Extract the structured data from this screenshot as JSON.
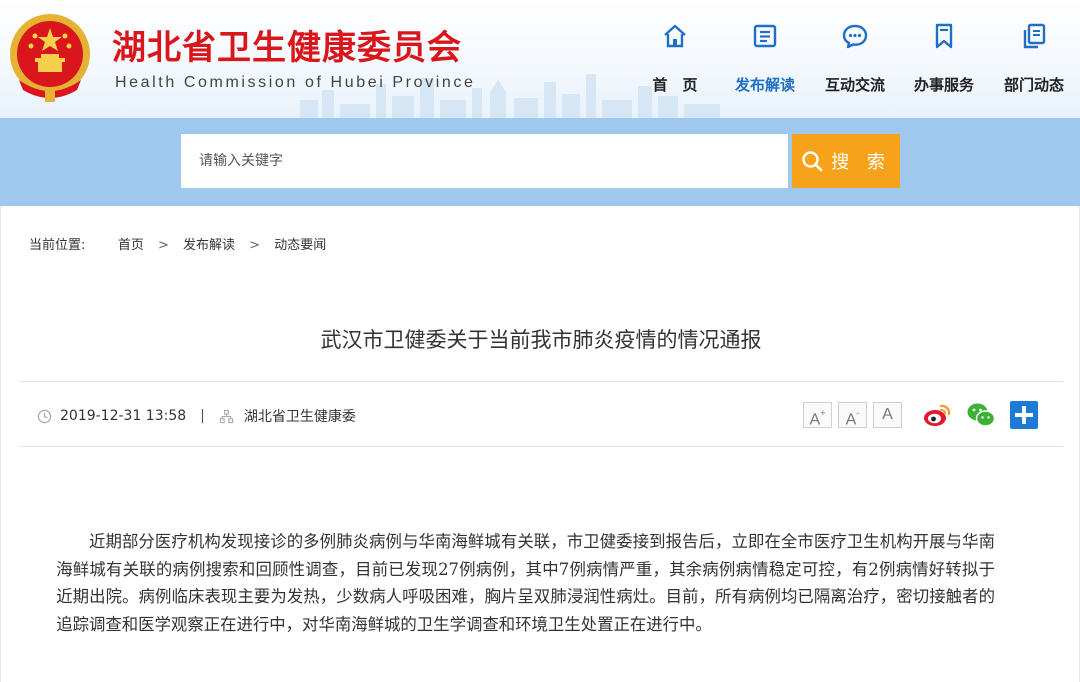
{
  "site": {
    "title": "湖北省卫生健康委员会",
    "subtitle": "Health Commission of Hubei Province"
  },
  "nav": [
    {
      "label": "首　页",
      "icon": "home-icon",
      "active": false
    },
    {
      "label": "发布解读",
      "icon": "document-icon",
      "active": true
    },
    {
      "label": "互动交流",
      "icon": "chat-icon",
      "active": false
    },
    {
      "label": "办事服务",
      "icon": "bookmark-icon",
      "active": false
    },
    {
      "label": "部门动态",
      "icon": "copy-icon",
      "active": false
    }
  ],
  "search": {
    "placeholder": "请输入关键字",
    "button_label": "搜 索"
  },
  "breadcrumb": {
    "prefix": "当前位置:",
    "items": [
      "首页",
      "发布解读",
      "动态要闻"
    ],
    "separator": ">"
  },
  "article": {
    "title": "武汉市卫健委关于当前我市肺炎疫情的情况通报",
    "datetime": "2019-12-31 13:58",
    "meta_separator": "|",
    "source": "湖北省卫生健康委",
    "body": "近期部分医疗机构发现接诊的多例肺炎病例与华南海鲜城有关联，市卫健委接到报告后，立即在全市医疗卫生机构开展与华南海鲜城有关联的病例搜索和回顾性调查，目前已发现27例病例，其中7例病情严重，其余病例病情稳定可控，有2例病情好转拟于近期出院。病例临床表现主要为发热，少数病人呼吸困难，胸片呈双肺浸润性病灶。目前，所有病例均已隔离治疗，密切接触者的追踪调查和医学观察正在进行中，对华南海鲜城的卫生学调查和环境卫生处置正在进行中。"
  },
  "font_controls": {
    "increase": "A",
    "decrease": "A",
    "reset": "A",
    "plus_mark": "+",
    "minus_mark": "-"
  },
  "colors": {
    "title_red": "#d8161b",
    "nav_active": "#1f6fc4",
    "search_band": "#9ec8ee",
    "search_button": "#f7a21b",
    "weibo": "#e6162d",
    "wechat": "#3bb233",
    "share_more": "#1d7ad6"
  }
}
